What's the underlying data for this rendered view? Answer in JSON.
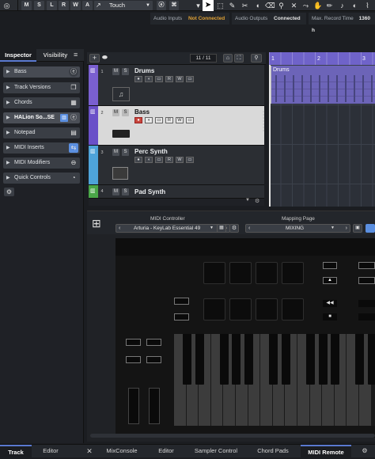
{
  "toolbar": {
    "buttons": [
      "M",
      "S",
      "L",
      "R",
      "W",
      "A"
    ],
    "automation_mode": "Touch",
    "record_time_label": "Max. Record Time",
    "record_time_value": "1360 h"
  },
  "status": {
    "audio_inputs_label": "Audio Inputs",
    "audio_inputs_value": "Not Connected",
    "audio_outputs_label": "Audio Outputs",
    "audio_outputs_value": "Connected"
  },
  "inspector": {
    "tabs": [
      "Inspector",
      "Visibility"
    ],
    "sections": [
      "Bass",
      "Track Versions",
      "Chords",
      "HALion So...SE",
      "Notepad",
      "MIDI Inserts",
      "MIDI Modifiers",
      "Quick Controls"
    ]
  },
  "tracklist": {
    "counter": "11 / 11"
  },
  "tracks": [
    {
      "num": "1",
      "name": "Drums",
      "color": "#7a5fd0"
    },
    {
      "num": "2",
      "name": "Bass",
      "color": "#6a50c8"
    },
    {
      "num": "3",
      "name": "Perc Synth",
      "color": "#4ea3d9"
    },
    {
      "num": "4",
      "name": "Pad Synth",
      "color": "#4aa648"
    }
  ],
  "ruler": [
    "1",
    "2",
    "3"
  ],
  "event": {
    "label": "Drums"
  },
  "midi_remote": {
    "controller_label": "MIDI Controller",
    "controller_value": "Arturia - KeyLab Essential 49",
    "mapping_label": "Mapping Page",
    "mapping_value": "MIXING"
  },
  "bottom_tabs": [
    "Track",
    "Editor",
    "MixConsole",
    "Editor",
    "Sampler Control",
    "Chord Pads",
    "MIDI Remote"
  ],
  "colors": {
    "accent": "#6f63c9",
    "status_bad": "#e0a135",
    "status_ok": "#d6d6d6"
  }
}
